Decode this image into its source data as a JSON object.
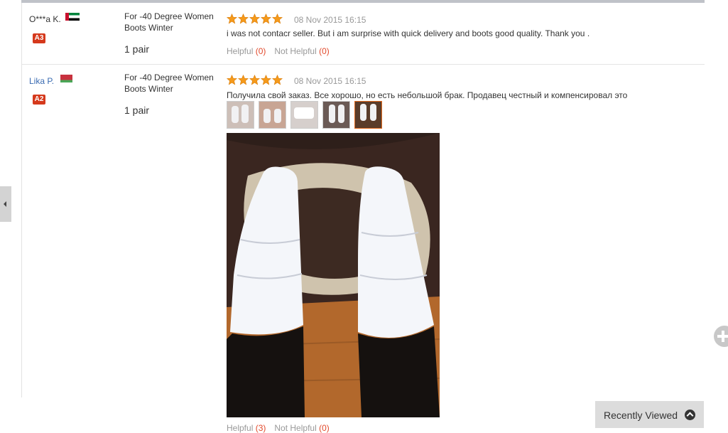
{
  "reviews": [
    {
      "user": "O***a K.",
      "country_flag": "flag-ae-icon",
      "level_badge": "A3",
      "product": "For -40 Degree Women Boots Winter",
      "quantity": "1 pair",
      "rating": 5,
      "date": "08 Nov 2015 16:15",
      "comment": "i was not contacr seller. But i am surprise with quick delivery and boots good quality. Thank you .",
      "helpful_label": "Helpful",
      "helpful_count": "(0)",
      "not_helpful_label": "Not Helpful",
      "not_helpful_count": "(0)"
    },
    {
      "user": "Lika P.",
      "country_flag": "flag-by-icon",
      "level_badge": "A2",
      "product": "For -40 Degree Women Boots Winter",
      "quantity": "1 pair",
      "rating": 5,
      "date": "08 Nov 2015 16:15",
      "comment": "Получила свой заказ. Все хорошо, но есть небольшой брак. Продавец честный и компенсировал это",
      "photo_count": 5,
      "selected_photo": 5,
      "helpful_label": "Helpful",
      "helpful_count": "(3)",
      "not_helpful_label": "Not Helpful",
      "not_helpful_count": "(0)"
    }
  ],
  "recently_viewed": {
    "label": "Recently Viewed",
    "icon": "chevron-up-icon"
  },
  "side_tab_icon": "caret-left-icon",
  "float_button_icon": "plus-icon",
  "colors": {
    "accent_red": "#e24a2c",
    "badge_red": "#d5391c",
    "link_blue": "#3a6bb2",
    "star_orange": "#f59a1b"
  }
}
